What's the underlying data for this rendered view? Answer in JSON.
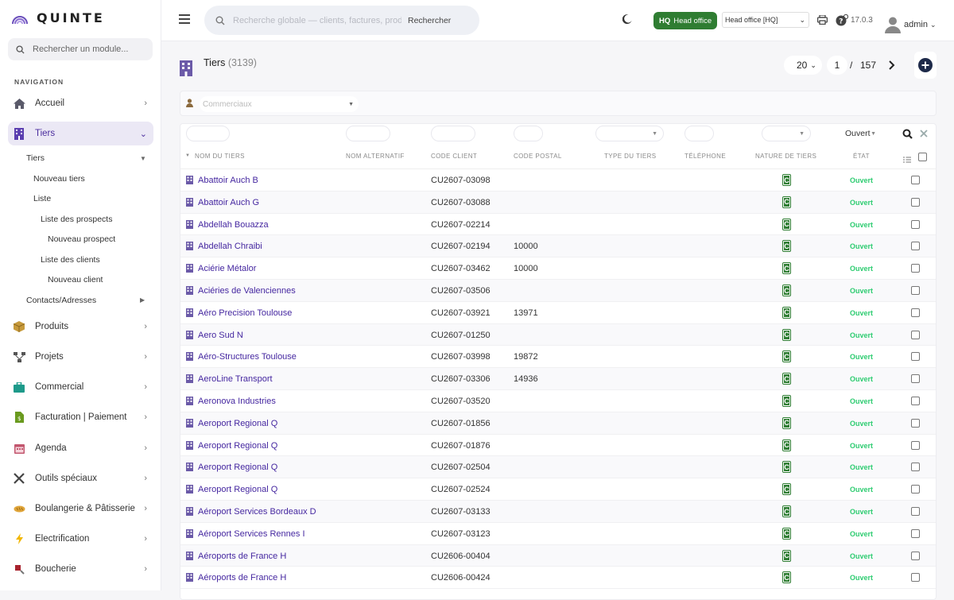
{
  "app": {
    "name": "QUINTE",
    "version": "17.0.3",
    "user": "admin"
  },
  "sidebar": {
    "search_placeholder": "Rechercher un module...",
    "nav_title": "NAVIGATION",
    "items": [
      {
        "label": "Accueil",
        "icon": "home-icon"
      },
      {
        "label": "Tiers",
        "icon": "building-icon",
        "active": true
      },
      {
        "label": "Produits",
        "icon": "box-icon"
      },
      {
        "label": "Projets",
        "icon": "project-icon"
      },
      {
        "label": "Commercial",
        "icon": "briefcase-icon"
      },
      {
        "label": "Facturation | Paiement",
        "icon": "invoice-icon"
      },
      {
        "label": "Agenda",
        "icon": "calendar-icon"
      },
      {
        "label": "Outils spéciaux",
        "icon": "tools-icon"
      },
      {
        "label": "Boulangerie & Pâtisserie",
        "icon": "bread-icon"
      },
      {
        "label": "Electrification",
        "icon": "lightning-icon"
      },
      {
        "label": "Boucherie",
        "icon": "meat-icon"
      }
    ],
    "sub_items": [
      {
        "label": "Tiers"
      },
      {
        "label": "Nouveau tiers"
      },
      {
        "label": "Liste"
      },
      {
        "label": "Liste des prospects"
      },
      {
        "label": "Nouveau prospect"
      },
      {
        "label": "Liste des clients"
      },
      {
        "label": "Nouveau client"
      },
      {
        "label": "Contacts/Adresses"
      }
    ]
  },
  "header": {
    "search_placeholder": "Recherche globale — clients, factures, prod",
    "search_button": "Rechercher",
    "badge_code": "HQ",
    "badge_label": "Head office",
    "entity_selected": "Head office [HQ]"
  },
  "page": {
    "title": "Tiers",
    "count": "(3139)",
    "per_page": "20",
    "current_page": "1",
    "separator": "/",
    "total_pages": "157",
    "commerciaux_placeholder": "Commerciaux",
    "state_filter": "Ouvert"
  },
  "table": {
    "columns": [
      "NOM DU TIERS",
      "NOM ALTERNATIF",
      "CODE CLIENT",
      "CODE POSTAL",
      "TYPE DU TIERS",
      "TÉLÉPHONE",
      "NATURE DE TIERS",
      "ÉTAT"
    ],
    "rows": [
      {
        "name": "Abattoir Auch B",
        "code": "CU2607-03098",
        "zip": "",
        "nature": "C",
        "state": "Ouvert"
      },
      {
        "name": "Abattoir Auch G",
        "code": "CU2607-03088",
        "zip": "",
        "nature": "C",
        "state": "Ouvert"
      },
      {
        "name": "Abdellah Bouazza",
        "code": "CU2607-02214",
        "zip": "",
        "nature": "C",
        "state": "Ouvert"
      },
      {
        "name": "Abdellah Chraibi",
        "code": "CU2607-02194",
        "zip": "10000",
        "nature": "C",
        "state": "Ouvert"
      },
      {
        "name": "Aciérie Métalor",
        "code": "CU2607-03462",
        "zip": "10000",
        "nature": "C",
        "state": "Ouvert"
      },
      {
        "name": "Aciéries de Valenciennes",
        "code": "CU2607-03506",
        "zip": "",
        "nature": "C",
        "state": "Ouvert"
      },
      {
        "name": "Aéro Precision Toulouse",
        "code": "CU2607-03921",
        "zip": "13971",
        "nature": "C",
        "state": "Ouvert"
      },
      {
        "name": "Aero Sud N",
        "code": "CU2607-01250",
        "zip": "",
        "nature": "C",
        "state": "Ouvert"
      },
      {
        "name": "Aéro-Structures Toulouse",
        "code": "CU2607-03998",
        "zip": "19872",
        "nature": "C",
        "state": "Ouvert"
      },
      {
        "name": "AeroLine Transport",
        "code": "CU2607-03306",
        "zip": "14936",
        "nature": "C",
        "state": "Ouvert"
      },
      {
        "name": "Aeronova Industries",
        "code": "CU2607-03520",
        "zip": "",
        "nature": "C",
        "state": "Ouvert"
      },
      {
        "name": "Aeroport Regional Q",
        "code": "CU2607-01856",
        "zip": "",
        "nature": "C",
        "state": "Ouvert"
      },
      {
        "name": "Aeroport Regional Q",
        "code": "CU2607-01876",
        "zip": "",
        "nature": "C",
        "state": "Ouvert"
      },
      {
        "name": "Aeroport Regional Q",
        "code": "CU2607-02504",
        "zip": "",
        "nature": "C",
        "state": "Ouvert"
      },
      {
        "name": "Aeroport Regional Q",
        "code": "CU2607-02524",
        "zip": "",
        "nature": "C",
        "state": "Ouvert"
      },
      {
        "name": "Aéroport Services Bordeaux D",
        "code": "CU2607-03133",
        "zip": "",
        "nature": "C",
        "state": "Ouvert"
      },
      {
        "name": "Aéroport Services Rennes I",
        "code": "CU2607-03123",
        "zip": "",
        "nature": "C",
        "state": "Ouvert"
      },
      {
        "name": "Aéroports de France H",
        "code": "CU2606-00404",
        "zip": "",
        "nature": "C",
        "state": "Ouvert"
      },
      {
        "name": "Aéroports de France H",
        "code": "CU2606-00424",
        "zip": "",
        "nature": "C",
        "state": "Ouvert"
      }
    ]
  },
  "colors": {
    "accent": "#4527a0",
    "nature_badge": "#2e7d32",
    "state_open": "#2ecc71",
    "hq_badge": "#2f7d32"
  }
}
